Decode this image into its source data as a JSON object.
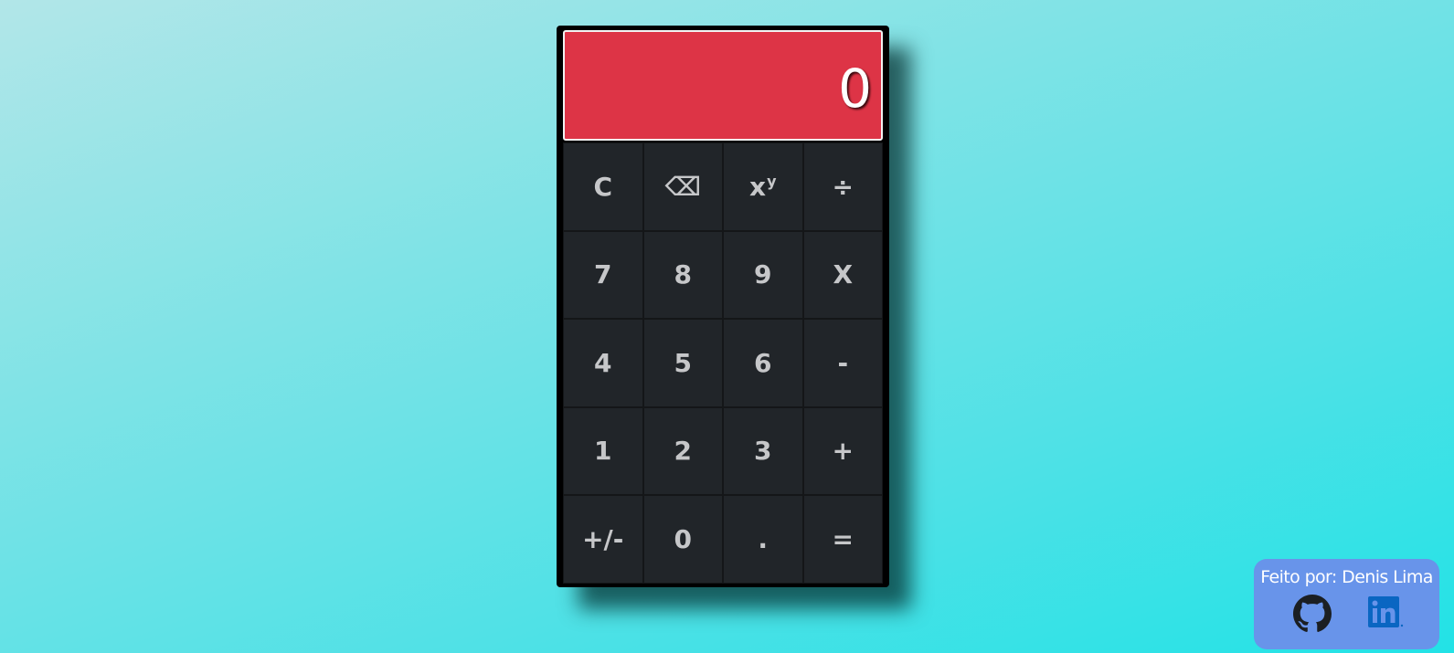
{
  "calculator": {
    "display_value": "0",
    "keys": [
      {
        "id": "clear",
        "label": "C"
      },
      {
        "id": "backspace",
        "label": "⌫"
      },
      {
        "id": "power",
        "label": "x",
        "sup": "y"
      },
      {
        "id": "divide",
        "label": "÷"
      },
      {
        "id": "7",
        "label": "7"
      },
      {
        "id": "8",
        "label": "8"
      },
      {
        "id": "9",
        "label": "9"
      },
      {
        "id": "multiply",
        "label": "X"
      },
      {
        "id": "4",
        "label": "4"
      },
      {
        "id": "5",
        "label": "5"
      },
      {
        "id": "6",
        "label": "6"
      },
      {
        "id": "subtract",
        "label": "-"
      },
      {
        "id": "1",
        "label": "1"
      },
      {
        "id": "2",
        "label": "2"
      },
      {
        "id": "3",
        "label": "3"
      },
      {
        "id": "add",
        "label": "+"
      },
      {
        "id": "sign",
        "label": "+/-"
      },
      {
        "id": "0",
        "label": "0"
      },
      {
        "id": "decimal",
        "label": "."
      },
      {
        "id": "equals",
        "label": "="
      }
    ]
  },
  "credits": {
    "text": "Feito por: Denis Lima",
    "links": [
      {
        "icon": "github-icon"
      },
      {
        "icon": "linkedin-icon"
      }
    ]
  },
  "colors": {
    "display_bg": "#dd3446",
    "key_bg": "#212529",
    "key_text": "#c6c7c9",
    "credits_bg": "#6894ea",
    "linkedin": "#0a66c2"
  }
}
